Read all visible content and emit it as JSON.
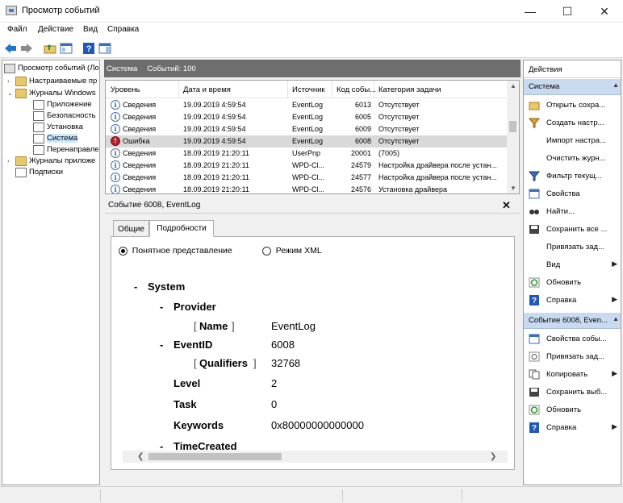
{
  "window": {
    "title": "Просмотр событий"
  },
  "menu": [
    "Файл",
    "Действие",
    "Вид",
    "Справка"
  ],
  "tree": [
    {
      "label": "Просмотр событий (Ло",
      "level": 0,
      "icon": "event-viewer-icon",
      "selected": false
    },
    {
      "label": "Настраиваемые пр",
      "level": 1,
      "icon": "folder-icon",
      "selected": false
    },
    {
      "label": "Журналы Windows",
      "level": 1,
      "icon": "folder-icon",
      "selected": false
    },
    {
      "label": "Приложение",
      "level": 2,
      "icon": "log-icon",
      "selected": false
    },
    {
      "label": "Безопасность",
      "level": 2,
      "icon": "log-icon",
      "selected": false
    },
    {
      "label": "Установка",
      "level": 2,
      "icon": "log-icon",
      "selected": false
    },
    {
      "label": "Система",
      "level": 2,
      "icon": "log-icon",
      "selected": true
    },
    {
      "label": "Перенаправле",
      "level": 2,
      "icon": "log-icon",
      "selected": false
    },
    {
      "label": "Журналы приложе",
      "level": 1,
      "icon": "folder-icon",
      "selected": false
    },
    {
      "label": "Подписки",
      "level": 1,
      "icon": "subscriptions-icon",
      "selected": false
    }
  ],
  "center": {
    "title": "Система",
    "count": "Событий: 100"
  },
  "grid": {
    "columns": [
      "Уровень",
      "Дата и время",
      "Источник",
      "Код собы...",
      "Категория задачи"
    ],
    "rows": [
      {
        "level": "Сведения",
        "type": "info",
        "date": "19.09.2019 4:59:54",
        "source": "EventLog",
        "code": "6013",
        "category": "Отсутствует"
      },
      {
        "level": "Сведения",
        "type": "info",
        "date": "19.09.2019 4:59:54",
        "source": "EventLog",
        "code": "6005",
        "category": "Отсутствует"
      },
      {
        "level": "Сведения",
        "type": "info",
        "date": "19.09.2019 4:59:54",
        "source": "EventLog",
        "code": "6009",
        "category": "Отсутствует"
      },
      {
        "level": "Ошибка",
        "type": "error",
        "date": "19.09.2019 4:59:54",
        "source": "EventLog",
        "code": "6008",
        "category": "Отсутствует"
      },
      {
        "level": "Сведения",
        "type": "info",
        "date": "18.09.2019 21:20:11",
        "source": "UserPnp",
        "code": "20001",
        "category": "(7005)"
      },
      {
        "level": "Сведения",
        "type": "info",
        "date": "18.09.2019 21:20:11",
        "source": "WPD-Cl...",
        "code": "24579",
        "category": "Настройка драйвера после устан..."
      },
      {
        "level": "Сведения",
        "type": "info",
        "date": "18.09.2019 21:20:11",
        "source": "WPD-Cl...",
        "code": "24577",
        "category": "Настройка драйвера после устан..."
      },
      {
        "level": "Сведения",
        "type": "info",
        "date": "18.09.2019 21:20:11",
        "source": "WPD-Cl...",
        "code": "24576",
        "category": "Установка драйвера"
      }
    ]
  },
  "detail": {
    "title": "Событие 6008, EventLog",
    "tabs": [
      "Общие",
      "Подробности"
    ],
    "view_friendly": "Понятное представление",
    "view_xml": "Режим XML",
    "xml": {
      "system": "System",
      "provider": "Provider",
      "name_key": "Name",
      "name_val": "EventLog",
      "eventid_key": "EventID",
      "eventid_val": "6008",
      "qualifiers_key": "Qualifiers",
      "qualifiers_val": "32768",
      "level_key": "Level",
      "level_val": "2",
      "task_key": "Task",
      "task_val": "0",
      "keywords_key": "Keywords",
      "keywords_val": "0x80000000000000",
      "timecreated_key": "TimeCreated"
    }
  },
  "actions": {
    "title": "Действия",
    "section1": "Система",
    "items1": [
      {
        "label": "Открыть сохра...",
        "icon": "open-folder-icon"
      },
      {
        "label": "Создать настр...",
        "icon": "filter-icon"
      },
      {
        "label": "Импорт настра...",
        "icon": "import-icon"
      },
      {
        "label": "Очистить журн...",
        "icon": "clear-log-icon"
      },
      {
        "label": "Фильтр текущ...",
        "icon": "filter-icon"
      },
      {
        "label": "Свойства",
        "icon": "properties-icon"
      },
      {
        "label": "Найти...",
        "icon": "find-icon"
      },
      {
        "label": "Сохранить все ...",
        "icon": "save-icon"
      },
      {
        "label": "Привязать зад...",
        "icon": "attach-task-icon"
      },
      {
        "label": "Вид",
        "icon": "view-icon",
        "submenu": true
      },
      {
        "label": "Обновить",
        "icon": "refresh-icon"
      },
      {
        "label": "Справка",
        "icon": "help-icon",
        "submenu": true
      }
    ],
    "section2": "Событие 6008, Even...",
    "items2": [
      {
        "label": "Свойства собы...",
        "icon": "event-properties-icon"
      },
      {
        "label": "Привязать зад...",
        "icon": "attach-task-icon"
      },
      {
        "label": "Копировать",
        "icon": "copy-icon",
        "submenu": true
      },
      {
        "label": "Сохранить выб...",
        "icon": "save-icon"
      },
      {
        "label": "Обновить",
        "icon": "refresh-icon"
      },
      {
        "label": "Справка",
        "icon": "help-icon",
        "submenu": true
      }
    ]
  }
}
